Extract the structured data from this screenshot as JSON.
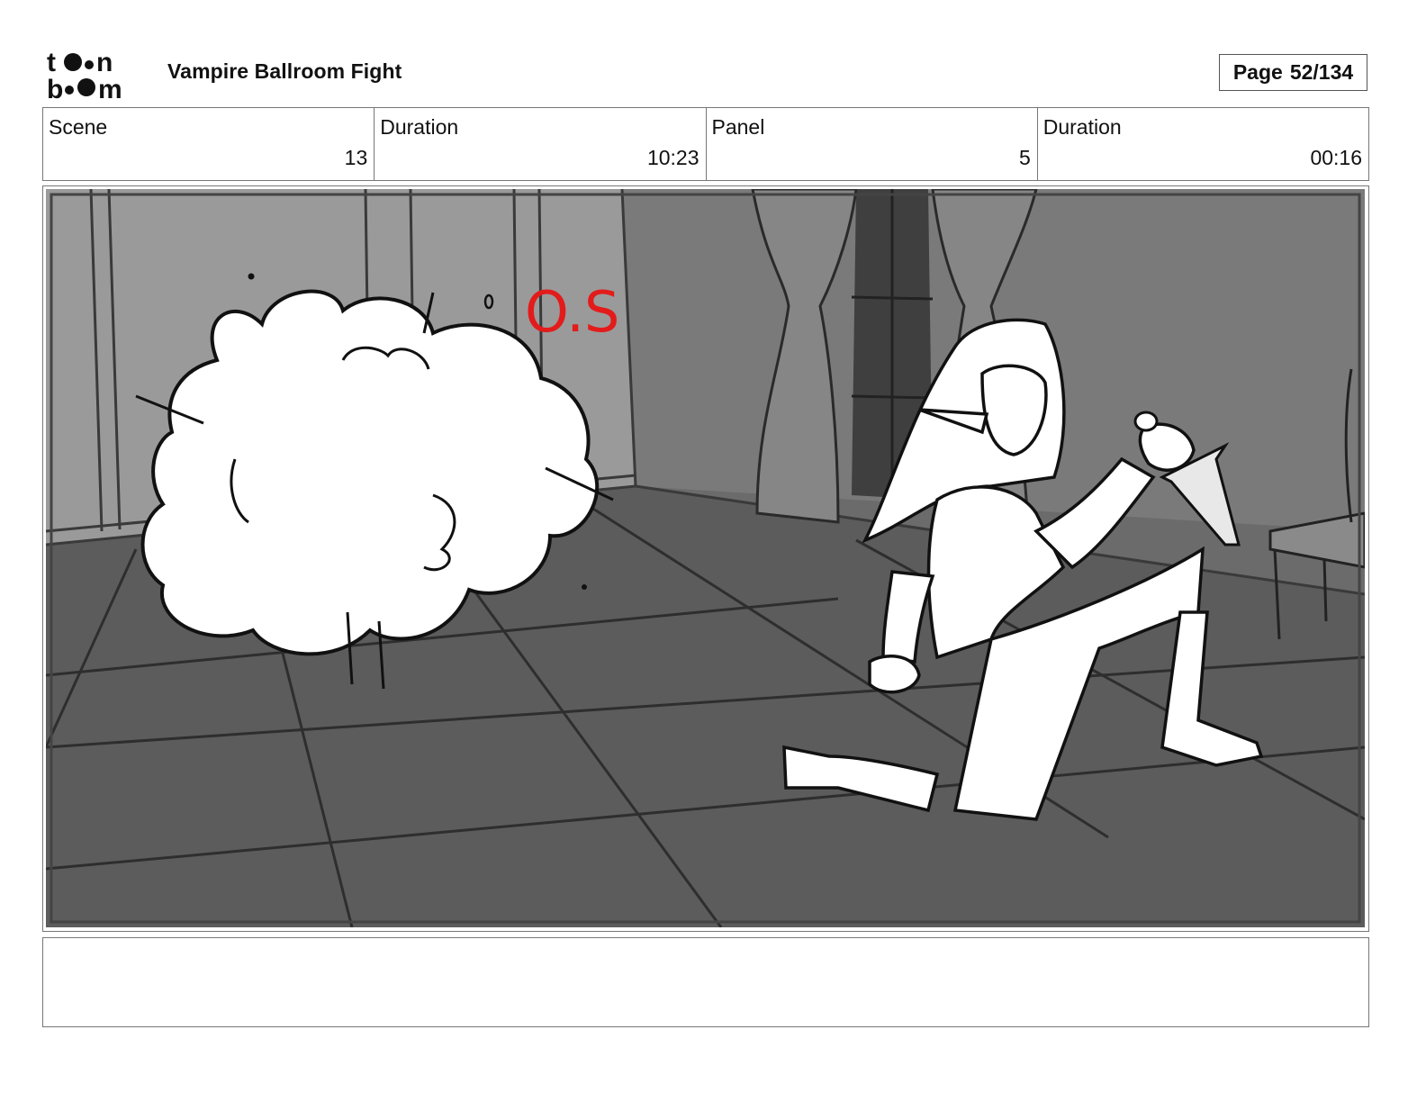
{
  "header": {
    "project_title": "Vampire Ballroom Fight",
    "page_label": "Page",
    "page_number": "52/134",
    "logo_name": "toon-boom-logo"
  },
  "info": {
    "scene_label": "Scene",
    "scene_value": "13",
    "scene_duration_label": "Duration",
    "scene_duration_value": "10:23",
    "panel_label": "Panel",
    "panel_value": "5",
    "panel_duration_label": "Duration",
    "panel_duration_value": "00:16"
  },
  "panel": {
    "annotation": "O.S",
    "annotation_color": "#e31b1b"
  },
  "notes": {
    "text": ""
  }
}
